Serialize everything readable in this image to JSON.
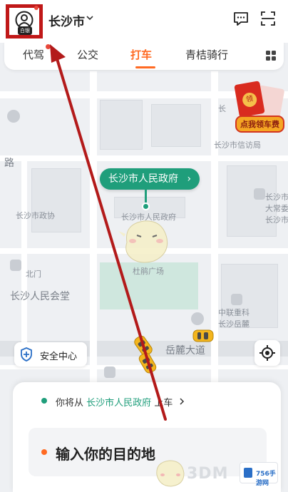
{
  "header": {
    "avatar_badge": "白银",
    "city": "长沙市",
    "icons": [
      "avatar-icon",
      "message-icon",
      "scan-icon",
      "chevron-down-icon"
    ]
  },
  "tabs": [
    {
      "label": "代驾",
      "active": false
    },
    {
      "label": "公交",
      "active": false
    },
    {
      "label": "打车",
      "active": true
    },
    {
      "label": "青桔骑行",
      "active": false
    }
  ],
  "promo": {
    "envelope_text": "领",
    "label": "点我领车费"
  },
  "map": {
    "labels": {
      "xinfang": "长沙市信访局",
      "chang": "长",
      "road_lu": "路",
      "gov_building": "长沙市人民政府",
      "zhengxie": "长沙市政协",
      "north_gate": "北门",
      "hall": "长沙人民会堂",
      "square": "杜鹃广场",
      "zhonglian": "中联重科",
      "yuelu": "长沙岳麓",
      "avenue": "岳麓大道",
      "right_top": "长沙市",
      "right_2": "长沙市",
      "right_3": "大常委"
    },
    "pickup_bubble": "长沙市人民政府",
    "pickup_chevron": "›"
  },
  "safety": {
    "label": "安全中心"
  },
  "panel": {
    "from_prefix": "你将从",
    "from_place": "长沙市人民政府",
    "from_suffix": "上车",
    "destination_placeholder": "输入你的目的地"
  },
  "watermark": {
    "text": "3DM",
    "box": "756手游网"
  },
  "colors": {
    "accent": "#ff6a22",
    "green": "#1f9e7b",
    "annotation": "#c01818"
  }
}
